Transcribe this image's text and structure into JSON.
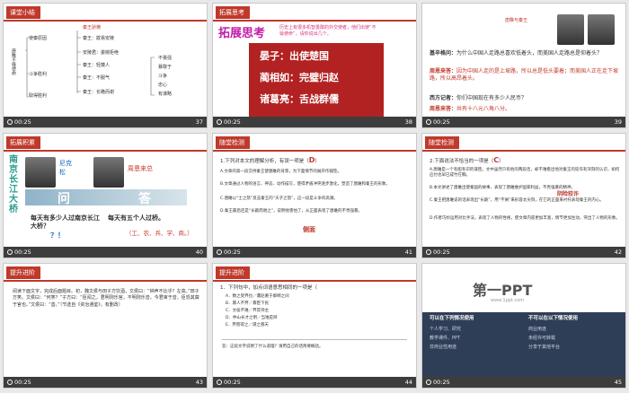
{
  "slides": [
    {
      "id": 37,
      "tag": "课堂小结",
      "page": "37",
      "time": "00:25",
      "tree": {
        "root": "唐雎不辱使命",
        "branch1": "使秦原因",
        "branch2": "斗争胜利",
        "branch3": "取得胜利",
        "top": "秦王骄横",
        "mid1": "秦王：欺易安陵",
        "mid2": "安陵君：委婉拒绝",
        "mid3": "秦王：轻蔑人",
        "mid4": "秦王：不服气",
        "mid5": "秦王：长跪而谢",
        "r1": "不畏强",
        "r2": "暴敢于",
        "r3": "斗争",
        "r4": "忠心",
        "r5": "有谋略"
      }
    },
    {
      "id": 38,
      "tag": "拓展思考",
      "page": "38",
      "time": "00:25",
      "title": "拓展思考",
      "desc": "历史上有很多机智勇敢的外交使者，他们出使“不辱使命”，请你说出几个。",
      "items": [
        "晏子：出使楚国",
        "蔺相如：完璧归赵",
        "诸葛亮：舌战群儒"
      ]
    },
    {
      "id": 39,
      "tag": "",
      "page": "39",
      "time": "00:25",
      "cap": "唐雎与秦王",
      "rows": [
        {
          "k": "基辛格问：",
          "v": "为什么中国人走路总喜欢低着头，而美国人走路总是仰着头？"
        },
        {
          "k": "周恩来答：",
          "v": "因为中国人走的是上坡路，所以总是低头要着；而美国人正在走下坡路，所以高昂着头。"
        },
        {
          "k": "西方记者：",
          "v": "你们中国现在有多少人民币？"
        },
        {
          "k": "周恩来答：",
          "v": "共有十八元八角八分。"
        }
      ]
    },
    {
      "id": 40,
      "tag": "拓展积累",
      "page": "40",
      "time": "00:25",
      "left": "南京长江大桥",
      "n1": "尼克",
      "n2": "松",
      "n3": "周恩来总",
      "q1": "问",
      "q2": "答",
      "say1": "每天有多少人过南京长江大桥？",
      "say2": "每天有五个人过桥。",
      "hint": "（工、农、兵、学、商。）",
      "qm": "？！"
    },
    {
      "id": 41,
      "tag": "随堂检测",
      "page": "41",
      "time": "00:25",
      "q": "1.下列对本文的理解分析，有误一项是（",
      "ans": "D",
      "end": "）",
      "opts": [
        "A.文章的第一段交待秦王使唐雎的背景，为下面情节的展开作铺垫。",
        "B.文章通过人物的语言、神态、动作描写，使得矛盾冲突逐步激化，塑造了唐雎和秦王的形象。",
        "C.唐雎以“士之怒”反击秦王的“天子之怒”，这一段是斗争的高潮。",
        "D.秦王最后还是“长跪而谢之”，说明他害怕了，从正面表现了唐雎的不畏强暴。"
      ],
      "mark": "侧面"
    },
    {
      "id": 42,
      "tag": "随堂检测",
      "page": "42",
      "time": "00:25",
      "q": "2.下面说法不恰当的一项是（",
      "ans": "C",
      "end": "）",
      "opts": [
        "A.唐雎是一个有胆有识的谋臣。文中虽然只有他的两段话，却不难看出他对秦王的狡诈有深刻的认识，如何应付也早已成竹在胸。",
        "B.本文讲述了唐雎出使秦国的故事，表现了唐雎维护国家利益，不畏强暴的精神。",
        "C.秦王把唐雎说的话表现出“长跪”，用“不屑”来形容太尖刻，在它的正面来衬托表现秦王的内心。",
        "D.作者巧妙运用对比手法，表现了人物的性格，使文章内容更加丰富，情节更加生动，突出了人物的形象。"
      ],
      "mark1": "阴险狡诈"
    },
    {
      "id": 43,
      "tag": "提升进阶",
      "page": "43",
      "time": "00:25",
      "body": "阅读下面文字，完成后面题目。初，魏文侯与田子方饮酒，文侯曰：“钟声不比乎？左高。”田子方笑。文侯曰：“何笑？”子方曰：“臣闻之，君明则乐官，不明则乐音。今君审于音，臣恐其聋于官也。”文侯曰：“善。”（节选自《资治通鉴》，有删改）"
    },
    {
      "id": 44,
      "tag": "提升进阶",
      "page": "44",
      "time": "00:25",
      "q": "1．下列句中，加点词语意思相同的一项是（",
      "opts": [
        "A．数之受弃也／遭赵奢于邯郸之间",
        "B．寡人不弃／寡臣下民",
        "C．文侯不难／弃其师主",
        "D．仲山长才之明／当谁是辨",
        "E．弃而得之／谓之聋天"
      ],
      "note": "答：这段文字说明了什么道理？请用自己的话简要概括。"
    },
    {
      "id": 45,
      "tag": "",
      "page": "45",
      "time": "00:25",
      "logo": "第一PPT",
      "site": "www.1ppt.com",
      "col1": "可以在下列情况使用",
      "col2": "不可以在以下情况使用",
      "c1lines": [
        "个人学习、研究",
        "教学课件、PPT",
        "非商业性用途"
      ],
      "c2lines": [
        "商业用途",
        "未经许可转载",
        "分享于其他平台"
      ]
    }
  ]
}
